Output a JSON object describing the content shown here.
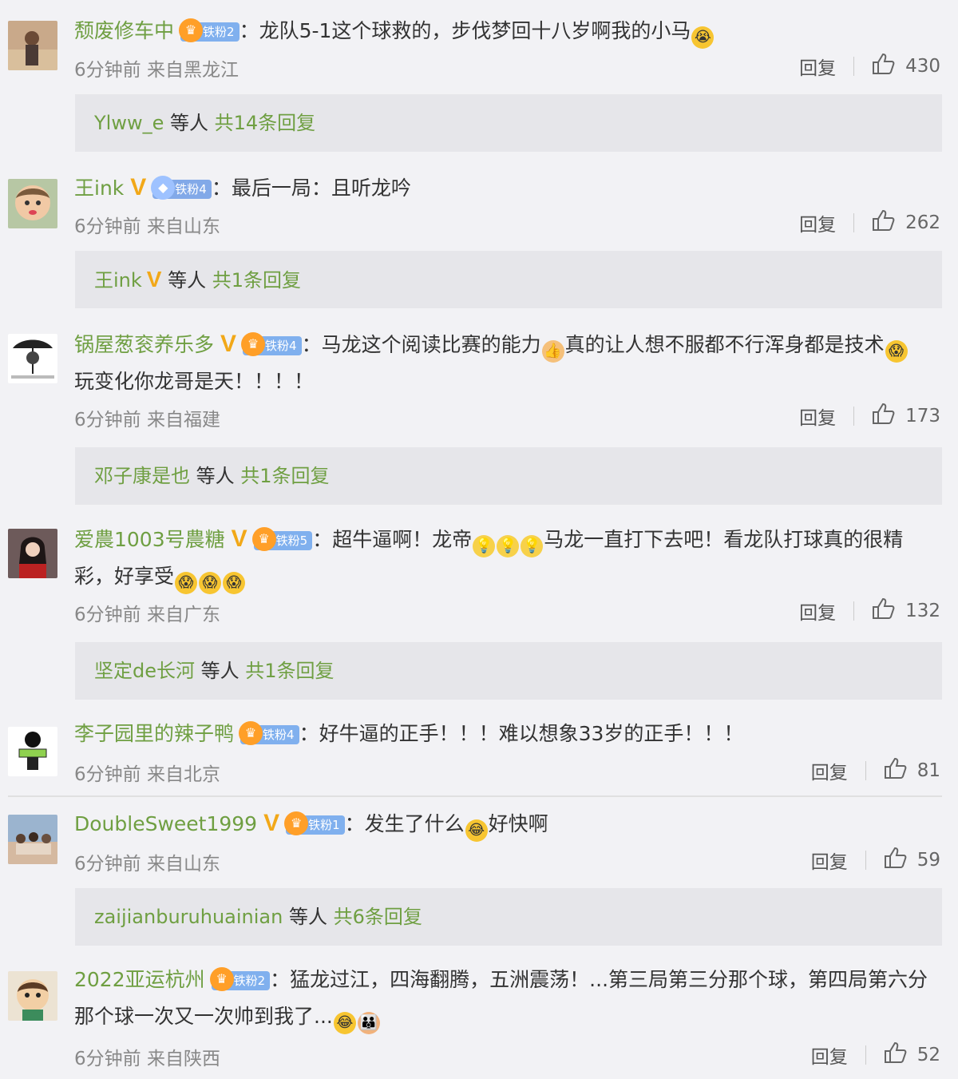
{
  "comments": [
    {
      "username": "颓废修车中",
      "verified": false,
      "fan_badge": "铁粉2",
      "text": "：龙队5-1这个球救的，步伐梦回十八岁啊我的小马",
      "text2": "",
      "emojis": [
        "crying-emoji"
      ],
      "time": "6分钟前",
      "location": "来自黑龙江",
      "reply_label": "回复",
      "likes": "430",
      "replies": {
        "names": "Ylww_e",
        "others": " 等人 ",
        "count": "共14条回复"
      }
    },
    {
      "username": "王ink",
      "verified": true,
      "fan_badge": "铁粉4",
      "text": "：最后一局：且听龙吟",
      "text2": "",
      "time": "6分钟前",
      "location": "来自山东",
      "reply_label": "回复",
      "likes": "262",
      "replies": {
        "names": "王ink",
        "others": " 等人 ",
        "count": "共1条回复"
      }
    },
    {
      "username": "锅屋葱衮养乐多",
      "verified": true,
      "fan_badge": "铁粉4",
      "text": "：马龙这个阅读比赛的能力",
      "text_b": "真的让人想不服都不行浑身都是技术",
      "text2": "玩变化你龙哥是天！！！！",
      "time": "6分钟前",
      "location": "来自福建",
      "reply_label": "回复",
      "likes": "173",
      "replies": {
        "names": "邓子康是也",
        "others": " 等人 ",
        "count": "共1条回复"
      }
    },
    {
      "username": "爱農1003号農糖",
      "verified": true,
      "fan_badge": "铁粉5",
      "text": "：超牛逼啊！龙帝",
      "text_b": "马龙一直打下去吧！看龙队打球真的很精",
      "text2": "彩，好享受",
      "time": "6分钟前",
      "location": "来自广东",
      "reply_label": "回复",
      "likes": "132",
      "replies": {
        "names": "坚定de长河",
        "others": " 等人 ",
        "count": "共1条回复"
      }
    },
    {
      "username": "李子园里的辣子鸭",
      "verified": false,
      "fan_badge": "铁粉4",
      "text": "：好牛逼的正手！！！难以想象33岁的正手！！！",
      "text2": "",
      "time": "6分钟前",
      "location": "来自北京",
      "reply_label": "回复",
      "likes": "81"
    },
    {
      "username": "DoubleSweet1999",
      "verified": true,
      "fan_badge": "铁粉1",
      "text": "：发生了什么",
      "text_b": "好快啊",
      "text2": "",
      "time": "6分钟前",
      "location": "来自山东",
      "reply_label": "回复",
      "likes": "59",
      "replies": {
        "names": "zaijianburuhuainian",
        "others": " 等人 ",
        "count": "共6条回复"
      }
    },
    {
      "username": "2022亚运杭州",
      "verified": false,
      "fan_badge": "铁粉2",
      "text": "：猛龙过江，四海翻腾，五洲震荡！...第三局第三分那个球，第四局第六分",
      "text2": "那个球一次又一次帅到我了...",
      "time": "6分钟前",
      "location": "来自陕西",
      "reply_label": "回复",
      "likes": "52"
    }
  ],
  "colors": {
    "username": "#6f9f42",
    "verified_v": "#f2a818",
    "fan_badge_bg": "#80b0ee",
    "replies_bg": "#e6e6ea",
    "page_bg": "#f2f2f5"
  }
}
